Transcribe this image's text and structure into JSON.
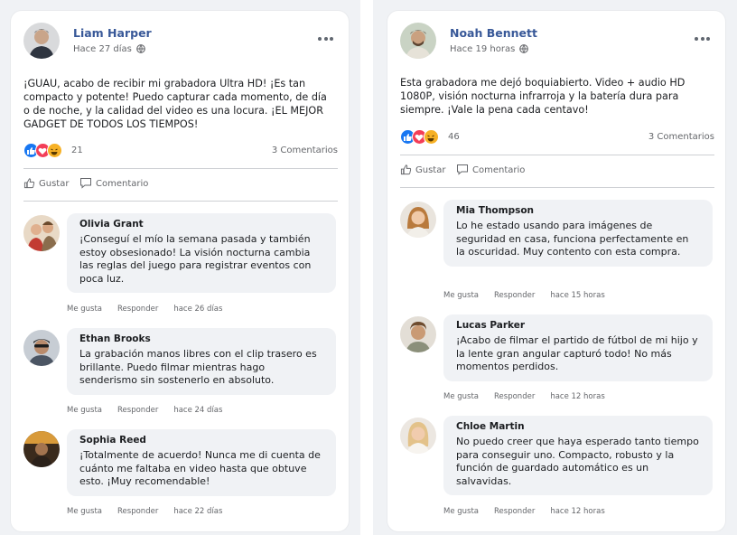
{
  "posts": [
    {
      "author": "Liam Harper",
      "time": "Hace 27 días",
      "text": "¡GUAU, acabo de recibir mi grabadora Ultra HD! ¡Es tan compacto y potente! Puedo capturar cada momento, de día o de noche, y la calidad del video es una locura. ¡EL MEJOR GADGET DE TODOS LOS TIEMPOS!",
      "reaction_count": "21",
      "comments_label": "3 Comentarios",
      "like_label": "Gustar",
      "comment_label": "Comentario",
      "comments": [
        {
          "name": "Olivia Grant",
          "text": "¡Conseguí el mío la semana pasada y también estoy obsesionado! La visión nocturna cambia las reglas del juego para registrar eventos con poca luz.",
          "like": "Me gusta",
          "reply": "Responder",
          "time": "hace 26 días"
        },
        {
          "name": "Ethan Brooks",
          "text": "La grabación manos libres con el clip trasero es brillante. Puedo filmar mientras hago senderismo sin sostenerlo en absoluto.",
          "like": "Me gusta",
          "reply": "Responder",
          "time": "hace 24 días"
        },
        {
          "name": "Sophia Reed",
          "text": "¡Totalmente de acuerdo! Nunca me di cuenta de cuánto me faltaba en video hasta que obtuve esto. ¡Muy recomendable!",
          "like": "Me gusta",
          "reply": "Responder",
          "time": "hace 22 días"
        }
      ]
    },
    {
      "author": "Noah Bennett",
      "time": "Hace 19 horas",
      "text": "Esta grabadora me dejó boquiabierto. Video + audio HD 1080P, visión nocturna infrarroja y la batería dura para siempre. ¡Vale la pena cada centavo!",
      "reaction_count": "46",
      "comments_label": "3 Comentarios",
      "like_label": "Gustar",
      "comment_label": "Comentario",
      "comments": [
        {
          "name": "Mia Thompson",
          "text": "Lo he estado usando para imágenes de seguridad en casa, funciona perfectamente en la oscuridad. Muy contento con esta compra.",
          "like": "Me gusta",
          "reply": "Responder",
          "time": "hace 15 horas"
        },
        {
          "name": "Lucas Parker",
          "text": "¡Acabo de filmar el partido de fútbol de mi hijo y la lente gran angular capturó todo! No más momentos perdidos.",
          "like": "Me gusta",
          "reply": "Responder",
          "time": "hace 12 horas"
        },
        {
          "name": "Chloe Martin",
          "text": "No puedo creer que haya esperado tanto tiempo para conseguir uno. Compacto, robusto y la función de guardado automático es un salvavidas.",
          "like": "Me gusta",
          "reply": "Responder",
          "time": "hace 12 horas"
        }
      ]
    }
  ],
  "colors": {
    "author": "#385898",
    "like_blue": "#1877f2",
    "love_red": "#f33e58",
    "haha_yellow": "#f7b125"
  },
  "icons": [
    "globe-icon",
    "more-options-icon",
    "like-reaction-icon",
    "love-reaction-icon",
    "haha-reaction-icon",
    "thumbs-up-icon",
    "comment-bubble-icon"
  ]
}
